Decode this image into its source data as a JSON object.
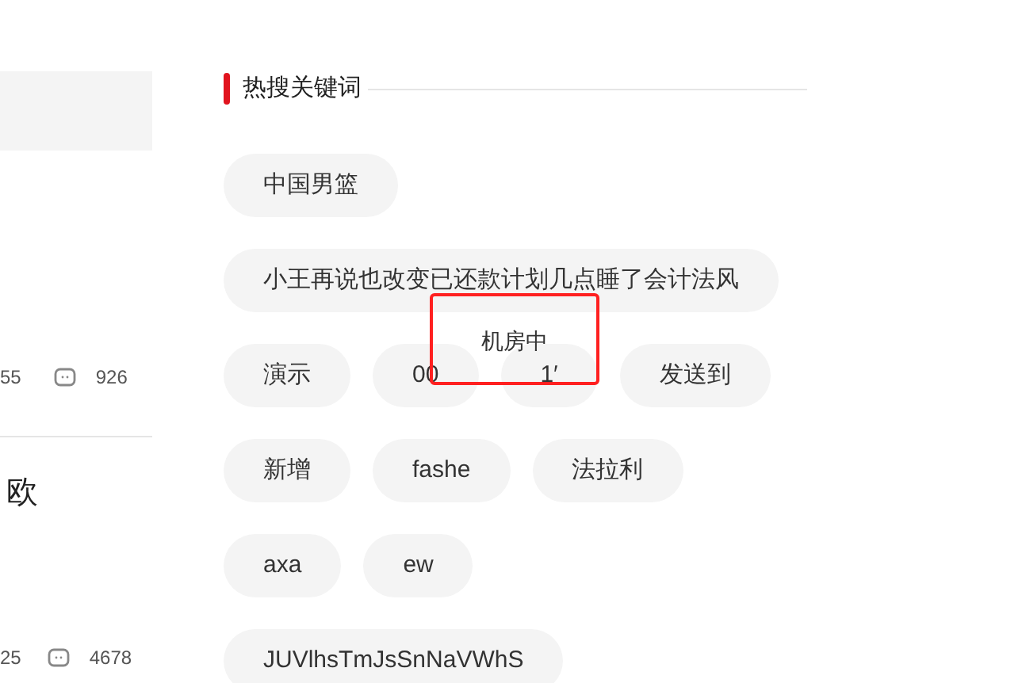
{
  "articles": [
    {
      "likes": "55",
      "comments": "926"
    },
    {
      "title": "欧",
      "likes": "25",
      "comments": "4678"
    }
  ],
  "hot_keywords": {
    "title": "热搜关键词",
    "keywords": [
      [
        "中国男篮"
      ],
      [
        "小王再说也改变已还款计划几点睡了会计法风"
      ],
      [
        "演示",
        "00",
        "1′",
        "发送到"
      ],
      [
        "新增",
        "fashe",
        "法拉利"
      ],
      [
        "axa",
        "ew"
      ],
      [
        "JUVlhsTmJsSnNaVWhS"
      ]
    ]
  },
  "overlay_box": {
    "label": "机房中"
  }
}
